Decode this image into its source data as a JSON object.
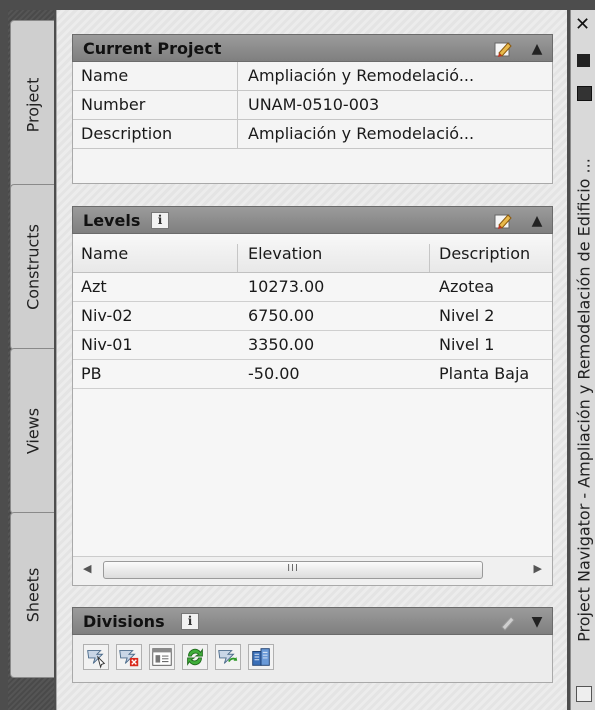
{
  "tabs": [
    {
      "label": "Project",
      "active": true
    },
    {
      "label": "Constructs",
      "active": false
    },
    {
      "label": "Views",
      "active": false
    },
    {
      "label": "Sheets",
      "active": false
    }
  ],
  "current_project": {
    "title": "Current Project",
    "rows": [
      {
        "key": "Name",
        "value": "Ampliación y Remodelació..."
      },
      {
        "key": "Number",
        "value": "UNAM-0510-003"
      },
      {
        "key": "Description",
        "value": "Ampliación y Remodelació..."
      }
    ]
  },
  "levels": {
    "title": "Levels",
    "info_icon": "i",
    "columns": [
      "Name",
      "Elevation",
      "Description"
    ],
    "rows": [
      {
        "name": "Azt",
        "elevation": "10273.00",
        "description": "Azotea"
      },
      {
        "name": "Niv-02",
        "elevation": "6750.00",
        "description": "Nivel 2"
      },
      {
        "name": "Niv-01",
        "elevation": "3350.00",
        "description": "Nivel 1"
      },
      {
        "name": "PB",
        "elevation": "-50.00",
        "description": "Planta Baja"
      }
    ],
    "scrollbar_grip": "III"
  },
  "divisions": {
    "title": "Divisions",
    "info_icon": "i"
  },
  "toolbar_icons": [
    "select-levels-icon",
    "delete-level-icon",
    "level-properties-icon",
    "refresh-icon",
    "regenerate-icon",
    "building-icon"
  ],
  "palette": {
    "title": "Project Navigator - Ampliación y Remodelación de Edificio ...",
    "close": "✕"
  }
}
